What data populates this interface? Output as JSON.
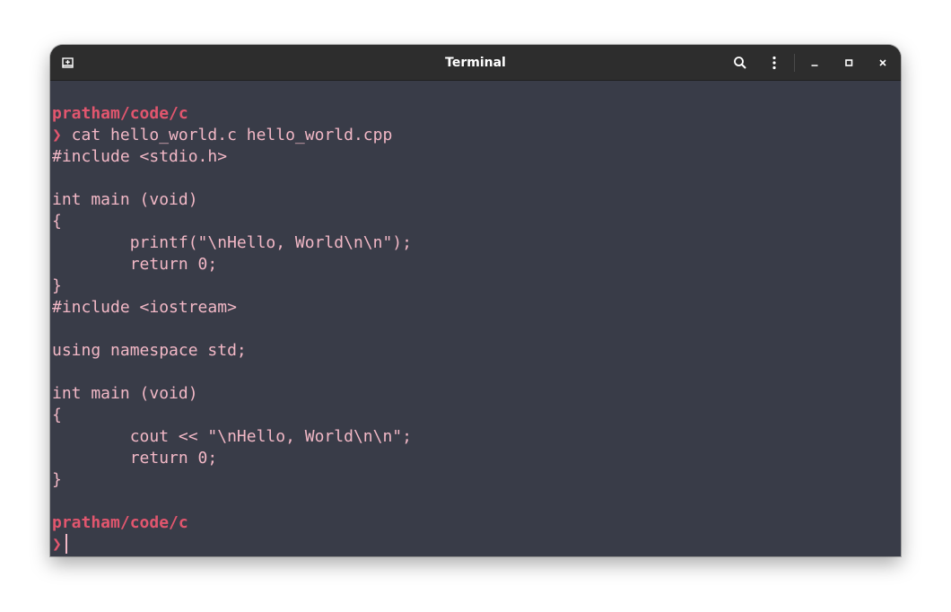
{
  "window": {
    "title": "Terminal"
  },
  "titlebar": {
    "icons": [
      "new-tab-icon",
      "search-icon",
      "menu-icon",
      "minimize-icon",
      "maximize-icon",
      "close-icon"
    ]
  },
  "terminal": {
    "prompt1_path": "pratham/code/c",
    "prompt_char": "❯",
    "command": " cat hello_world.c hello_world.cpp",
    "lines": [
      "#include <stdio.h>",
      "",
      "int main (void)",
      "{",
      "        printf(\"\\nHello, World\\n\\n\");",
      "        return 0;",
      "}",
      "#include <iostream>",
      "",
      "using namespace std;",
      "",
      "int main (void)",
      "{",
      "        cout << \"\\nHello, World\\n\\n\";",
      "        return 0;",
      "}",
      ""
    ],
    "prompt2_path": "pratham/code/c"
  },
  "colors": {
    "terminal_bg": "#393c48",
    "titlebar_bg": "#2d2d2d",
    "text": "#f2b8c6",
    "prompt": "#e2566e"
  }
}
